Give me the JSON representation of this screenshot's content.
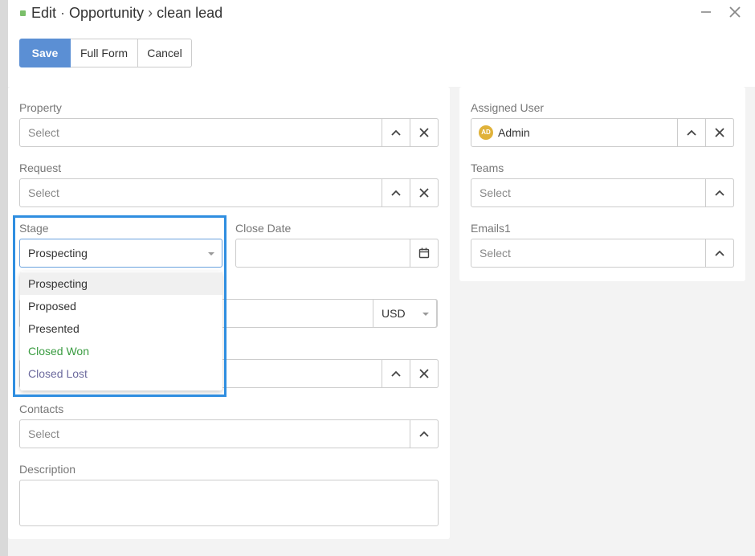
{
  "header": {
    "edit_label": "Edit",
    "separator": "·",
    "entity": "Opportunity",
    "breadcrumb_sep": "›",
    "record": "clean lead",
    "minimize_icon": "minimize-icon",
    "close_icon": "close-icon"
  },
  "toolbar": {
    "save_label": "Save",
    "full_form_label": "Full Form",
    "cancel_label": "Cancel"
  },
  "left": {
    "property": {
      "label": "Property",
      "placeholder": "Select"
    },
    "request": {
      "label": "Request",
      "placeholder": "Select"
    },
    "stage": {
      "label": "Stage",
      "value": "Prospecting"
    },
    "close_date": {
      "label": "Close Date",
      "value": ""
    },
    "amount": {
      "value": "",
      "currency": "USD"
    },
    "hidden_field": {
      "value": ""
    },
    "contacts": {
      "label": "Contacts",
      "placeholder": "Select"
    },
    "description": {
      "label": "Description",
      "value": ""
    }
  },
  "stage_options": [
    {
      "label": "Prospecting",
      "state": "active"
    },
    {
      "label": "Proposed",
      "state": "normal"
    },
    {
      "label": "Presented",
      "state": "normal"
    },
    {
      "label": "Closed Won",
      "state": "won"
    },
    {
      "label": "Closed Lost",
      "state": "lost"
    }
  ],
  "right": {
    "assigned_user": {
      "label": "Assigned User",
      "value": "Admin",
      "avatar_initials": "AD"
    },
    "teams": {
      "label": "Teams",
      "placeholder": "Select"
    },
    "emails": {
      "label": "Emails1",
      "placeholder": "Select"
    }
  },
  "colors": {
    "primary": "#5b8fd4",
    "highlight": "#2f8ee0",
    "won": "#3a9c41",
    "lost": "#6c6a9e",
    "avatar": "#e0b23a"
  }
}
